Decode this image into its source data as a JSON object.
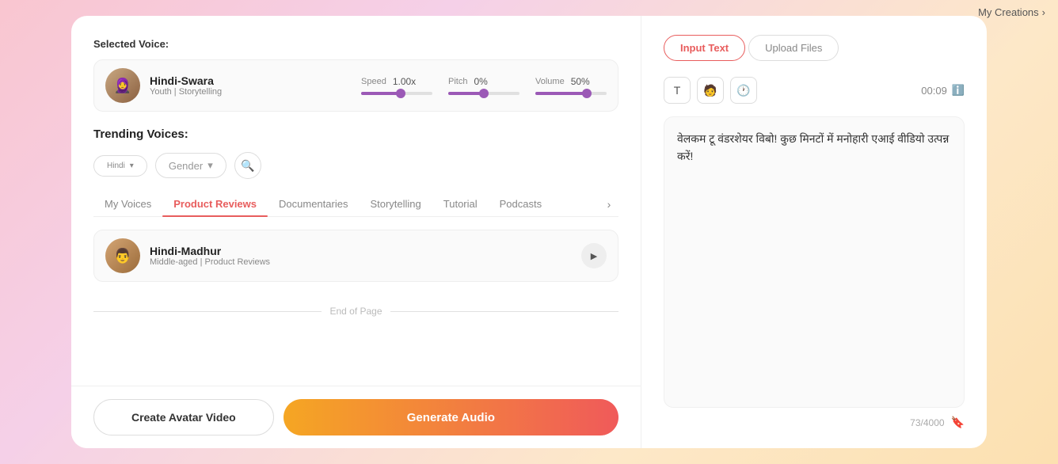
{
  "header": {
    "my_creations_label": "My Creations",
    "my_creations_arrow": "›"
  },
  "left_panel": {
    "selected_voice_label": "Selected Voice:",
    "voice": {
      "name": "Hindi-Swara",
      "subtitle": "Youth | Storytelling"
    },
    "controls": {
      "speed_label": "Speed",
      "speed_value": "1.00x",
      "pitch_label": "Pitch",
      "pitch_value": "0%",
      "volume_label": "Volume",
      "volume_value": "50%"
    },
    "trending_label": "Trending Voices:",
    "language_filter": "Hindi",
    "gender_filter": "Gender",
    "tabs": [
      {
        "label": "My Voices",
        "active": false
      },
      {
        "label": "Product Reviews",
        "active": true
      },
      {
        "label": "Documentaries",
        "active": false
      },
      {
        "label": "Storytelling",
        "active": false
      },
      {
        "label": "Tutorial",
        "active": false
      },
      {
        "label": "Podcasts",
        "active": false
      }
    ],
    "voice_list": [
      {
        "name": "Hindi-Madhur",
        "subtitle": "Middle-aged | Product Reviews"
      }
    ],
    "end_of_page_label": "End of Page",
    "create_avatar_btn": "Create Avatar Video",
    "generate_audio_btn": "Generate Audio"
  },
  "right_panel": {
    "tab_input_text": "Input Text",
    "tab_upload_files": "Upload Files",
    "toolbar_icons": {
      "text_icon": "T",
      "person_icon": "🧑",
      "clock_icon": "🕐"
    },
    "timestamp": "00:09",
    "text_content": "वेलकम टू वंडरशेयर विबो! कुछ मिनटों में मनोहारी एआई वीडियो उत्पन्न करें!",
    "char_count": "73/4000"
  }
}
